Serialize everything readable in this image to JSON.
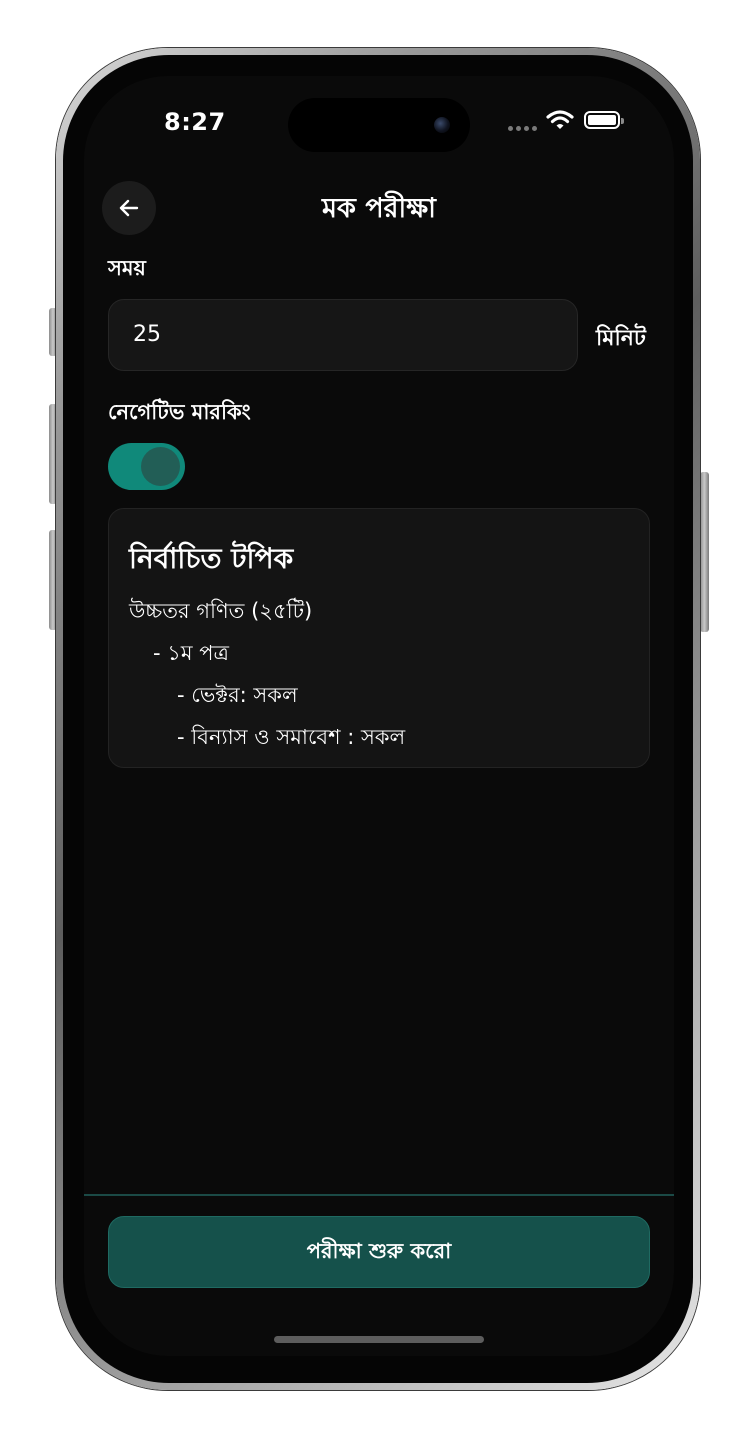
{
  "status_bar": {
    "time": "8:27"
  },
  "header": {
    "title": "মক পরীক্ষা",
    "back_icon": "arrow-left-icon"
  },
  "form": {
    "time_label": "সময়",
    "time_value": "25",
    "time_unit": "মিনিট",
    "negative_marking_label": "নেগেটিভ মারকিং",
    "negative_marking_enabled": true
  },
  "topics": {
    "title": "নির্বাচিত টপিক",
    "items": [
      "উচ্চতর গণিত (২৫টি)",
      "- ১ম পত্র",
      "- ভেক্টর: সকল",
      "- বিন্যাস ও সমাবেশ : সকল"
    ]
  },
  "footer": {
    "start_label": "পরীক্ষা শুরু করো"
  },
  "colors": {
    "accent": "#10897a",
    "button": "#15514b",
    "background": "#0a0a0a"
  }
}
